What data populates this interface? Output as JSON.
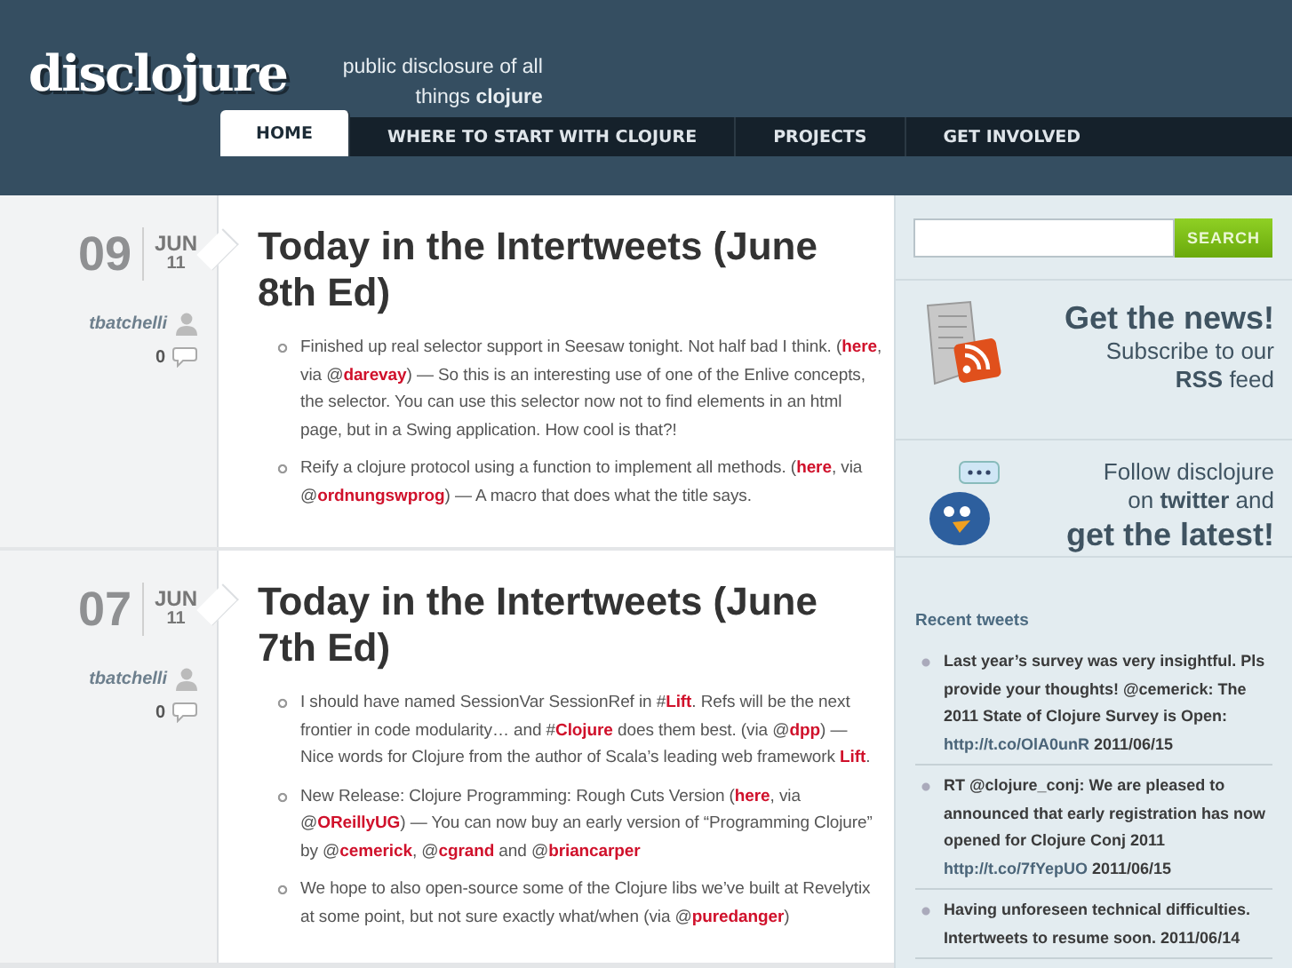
{
  "header": {
    "logo": "disclojure",
    "tagline": "public disclosure of all things **clojure**"
  },
  "nav": [
    {
      "label": "HOME",
      "selected": true
    },
    {
      "label": "WHERE TO START WITH CLOJURE",
      "selected": false
    },
    {
      "label": "PROJECTS",
      "selected": false
    },
    {
      "label": "GET INVOLVED",
      "selected": false
    }
  ],
  "posts": [
    {
      "day": "09",
      "month": "JUN",
      "year": "11",
      "author": "tbatchelli",
      "comments": "0",
      "title": "Today in the Intertweets (June 8th Ed)",
      "items": [
        [
          {
            "kind": "text",
            "text": "Finished up real selector support in Seesaw tonight. Not half bad I think. ("
          },
          {
            "kind": "link",
            "text": "here"
          },
          {
            "kind": "text",
            "text": ", via @"
          },
          {
            "kind": "link",
            "text": "darevay"
          },
          {
            "kind": "text",
            "text": ") — So this is an interesting use of one of the Enlive concepts, the selector. You can use this selector now not to find elements in an html page, but in a Swing application. How cool is that?!"
          }
        ],
        [
          {
            "kind": "text",
            "text": "Reify a clojure protocol using a function to implement all methods. ("
          },
          {
            "kind": "link",
            "text": "here"
          },
          {
            "kind": "text",
            "text": ", via @"
          },
          {
            "kind": "link",
            "text": "ordnungswprog"
          },
          {
            "kind": "text",
            "text": ") — A macro that does what the title says."
          }
        ]
      ]
    },
    {
      "day": "07",
      "month": "JUN",
      "year": "11",
      "author": "tbatchelli",
      "comments": "0",
      "title": "Today in the Intertweets (June 7th Ed)",
      "items": [
        [
          {
            "kind": "text",
            "text": "I should have named SessionVar SessionRef in #"
          },
          {
            "kind": "link",
            "text": "Lift"
          },
          {
            "kind": "text",
            "text": ". Refs will be the next frontier in code modularity… and #"
          },
          {
            "kind": "link",
            "text": "Clojure"
          },
          {
            "kind": "text",
            "text": " does them best. (via @"
          },
          {
            "kind": "link",
            "text": "dpp"
          },
          {
            "kind": "text",
            "text": ") — Nice words for Clojure from the author of Scala’s leading web framework "
          },
          {
            "kind": "link",
            "text": "Lift"
          },
          {
            "kind": "text",
            "text": "."
          }
        ],
        [
          {
            "kind": "text",
            "text": "New Release: Clojure Programming: Rough Cuts Version ("
          },
          {
            "kind": "link",
            "text": "here"
          },
          {
            "kind": "text",
            "text": ", via @"
          },
          {
            "kind": "link",
            "text": "OReillyUG"
          },
          {
            "kind": "text",
            "text": ") — You can now buy an early version of “Programming Clojure” by @"
          },
          {
            "kind": "link",
            "text": "cemerick"
          },
          {
            "kind": "text",
            "text": ", @"
          },
          {
            "kind": "link",
            "text": "cgrand"
          },
          {
            "kind": "text",
            "text": " and @"
          },
          {
            "kind": "link",
            "text": "briancarper"
          }
        ],
        [
          {
            "kind": "text",
            "text": "We hope to also open-source some of the Clojure libs we’ve built at Revelytix at some point, but not sure exactly what/when (via @"
          },
          {
            "kind": "link",
            "text": "puredanger"
          },
          {
            "kind": "text",
            "text": ")"
          }
        ]
      ]
    }
  ],
  "sidebar": {
    "search_button": "SEARCH",
    "rss": {
      "heading": "Get the news!",
      "line": "Subscribe to our",
      "feed": "**RSS** feed"
    },
    "twitter": {
      "line1": "Follow disclojure",
      "line2": "on **twitter** and",
      "heading": "get the latest!"
    },
    "recent_title": "Recent tweets",
    "tweets": [
      [
        {
          "kind": "text",
          "text": "Last year’s survey was very insightful. Pls provide your thoughts! @cemerick: The 2011 State of Clojure Survey is Open: "
        },
        {
          "kind": "link",
          "text": "http://t.co/OlA0unR"
        },
        {
          "kind": "text",
          "text": " 2011/06/15"
        }
      ],
      [
        {
          "kind": "text",
          "text": "RT @clojure_conj: We are pleased to announced that early registration has now opened for Clojure Conj 2011 "
        },
        {
          "kind": "link",
          "text": "http://t.co/7fYepUO"
        },
        {
          "kind": "text",
          "text": " 2011/06/15"
        }
      ],
      [
        {
          "kind": "text",
          "text": "Having unforeseen technical difficulties. Intertweets to resume soon. 2011/06/14"
        }
      ]
    ]
  }
}
